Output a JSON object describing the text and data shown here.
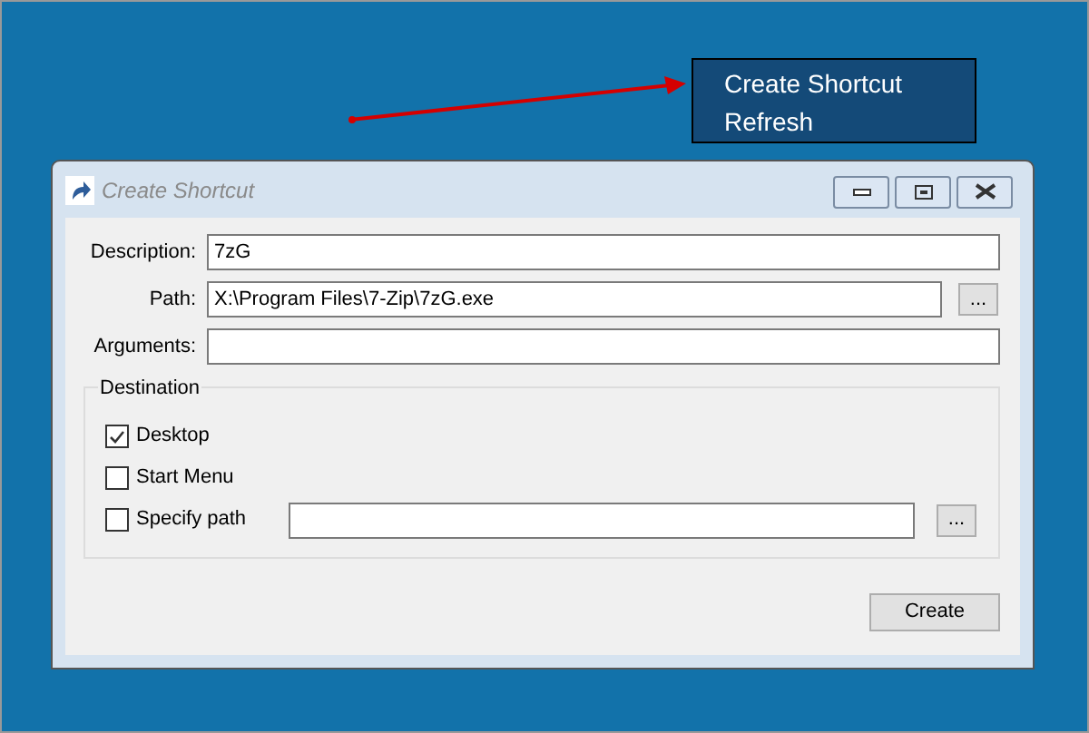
{
  "context_menu": {
    "items": [
      {
        "label": "Create Shortcut"
      },
      {
        "label": "Refresh"
      }
    ]
  },
  "window": {
    "title": "Create Shortcut"
  },
  "fields": [
    {
      "label": "Description:",
      "value": "7zG"
    },
    {
      "label": "Path:",
      "value": "X:\\Program Files\\7-Zip\\7zG.exe",
      "browse_label": "..."
    },
    {
      "label": "Arguments:"
    }
  ],
  "destination": {
    "title": "Destination",
    "options": [
      {
        "label": "Desktop",
        "checked": true,
        "kind": "checkbox"
      },
      {
        "label": "Start Menu",
        "checked": false,
        "kind": "checkbox"
      },
      {
        "label": "Specify path",
        "checked": false,
        "kind": "path",
        "browse_label": "..."
      }
    ]
  },
  "create_button": "Create"
}
